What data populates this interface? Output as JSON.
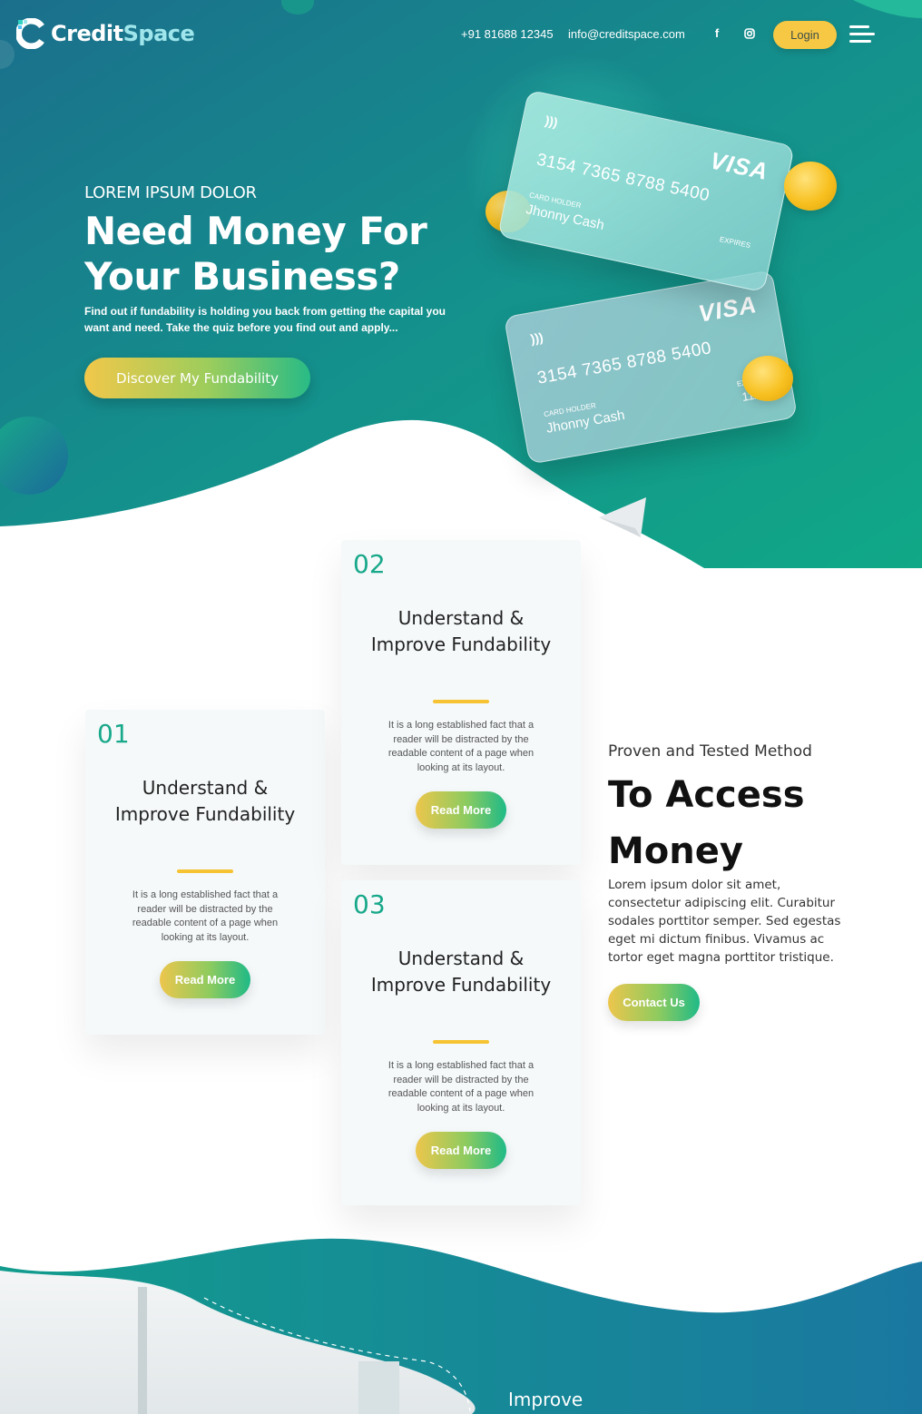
{
  "header": {
    "logo_primary": "Credit",
    "logo_accent": "Space",
    "phone": "+91 81688 12345",
    "email": "info@creditspace.com",
    "facebook_icon": "f",
    "login_label": "Login"
  },
  "hero": {
    "eyebrow": "LOREM IPSUM DOLOR",
    "title": "Need Money For Your Business?",
    "description": "Find out if fundability is holding you back from getting the capital you want and need. Take the quiz before you find out and apply...",
    "cta_label": "Discover My Fundability"
  },
  "cards": [
    {
      "brand": "VISA",
      "number": "3154 7365 8788 5400",
      "holder_label": "CARD HOLDER",
      "holder": "Jhonny Cash",
      "expires_label": "EXPIRES",
      "expires": ""
    },
    {
      "brand": "VISA",
      "number": "3154 7365 8788 5400",
      "holder_label": "CARD HOLDER",
      "holder": "Jhonny Cash",
      "expires_label": "EXPIRES",
      "expires": "11/27"
    }
  ],
  "steps": [
    {
      "number": "01",
      "title": "Understand & Improve Fundability",
      "description": "It is a long established fact that a reader will be distracted by the readable content of a page when looking at its layout.",
      "button": "Read More"
    },
    {
      "number": "02",
      "title": "Understand & Improve Fundability",
      "description": "It is a long established fact that a reader will be distracted by the readable content of a page when looking at its layout.",
      "button": "Read More"
    },
    {
      "number": "03",
      "title": "Understand & Improve Fundability",
      "description": "It is a long established fact that a reader will be distracted by the readable content of a page when looking at its layout.",
      "button": "Read More"
    }
  ],
  "method": {
    "eyebrow": "Proven and Tested Method",
    "title": "To Access Money",
    "description": "Lorem ipsum dolor sit amet, consectetur adipiscing elit. Curabitur sodales porttitor semper. Sed egestas eget mi dictum finibus. Vivamus ac tortor eget magna porttitor tristique.",
    "cta_label": "Contact Us"
  },
  "next_section": {
    "heading": "Improve"
  },
  "colors": {
    "teal_dark": "#1b7a8e",
    "teal": "#12a28a",
    "accent_green": "#18a88a",
    "yellow": "#f6c333"
  },
  "icons": [
    "facebook-icon",
    "instagram-icon",
    "menu-icon",
    "nfc-icon",
    "coin-icon"
  ]
}
